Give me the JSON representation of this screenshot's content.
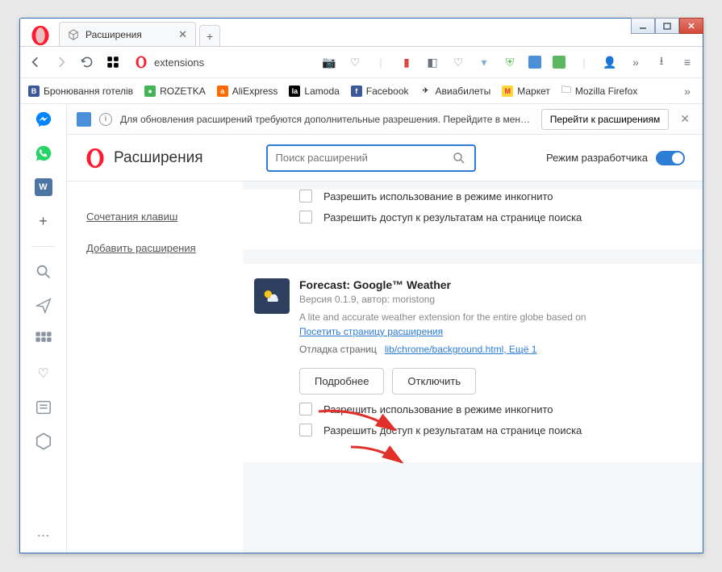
{
  "window": {
    "tab_title": "Расширения",
    "url_text": "extensions"
  },
  "bookmarks": [
    {
      "label": "Бронювання готелів",
      "bg": "#3b5998",
      "t": "B"
    },
    {
      "label": "ROZETKA",
      "bg": "#44b556",
      "t": "●"
    },
    {
      "label": "AliExpress",
      "bg": "#ff6a00",
      "t": "A"
    },
    {
      "label": "Lamoda",
      "bg": "#000",
      "t": "la"
    },
    {
      "label": "Facebook",
      "bg": "#3b5998",
      "t": "f"
    },
    {
      "label": "Авиабилеты",
      "bg": "#f5c518",
      "t": "✈"
    },
    {
      "label": "Маркет",
      "bg": "#ffd43b",
      "t": "M"
    },
    {
      "label": "Mozilla Firefox",
      "bg": "transparent",
      "t": "📁"
    }
  ],
  "notif": {
    "text": "Для обновления расширений требуются дополнительные разрешения. Перейдите в менеджер ра...",
    "button": "Перейти к расширениям"
  },
  "ext_header": {
    "title": "Расширения",
    "search_placeholder": "Поиск расширений",
    "dev_mode": "Режим разработчика"
  },
  "nav": {
    "shortcuts": "Сочетания клавиш",
    "add": "Добавить расширения"
  },
  "perms": {
    "incognito": "Разрешить использование в режиме инкогнито",
    "search": "Разрешить доступ к результатам на странице поиска"
  },
  "ext": {
    "name": "Forecast: Google™ Weather",
    "version": "Версия 0.1.9, автор: moristong",
    "desc": "A lite and accurate weather extension for the entire globe based on",
    "visit": "Посетить страницу расширения",
    "debug_lbl": "Отладка страниц",
    "debug_links": "lib/chrome/background.html,  Ещё 1",
    "more": "Подробнее",
    "disable": "Отключить"
  }
}
